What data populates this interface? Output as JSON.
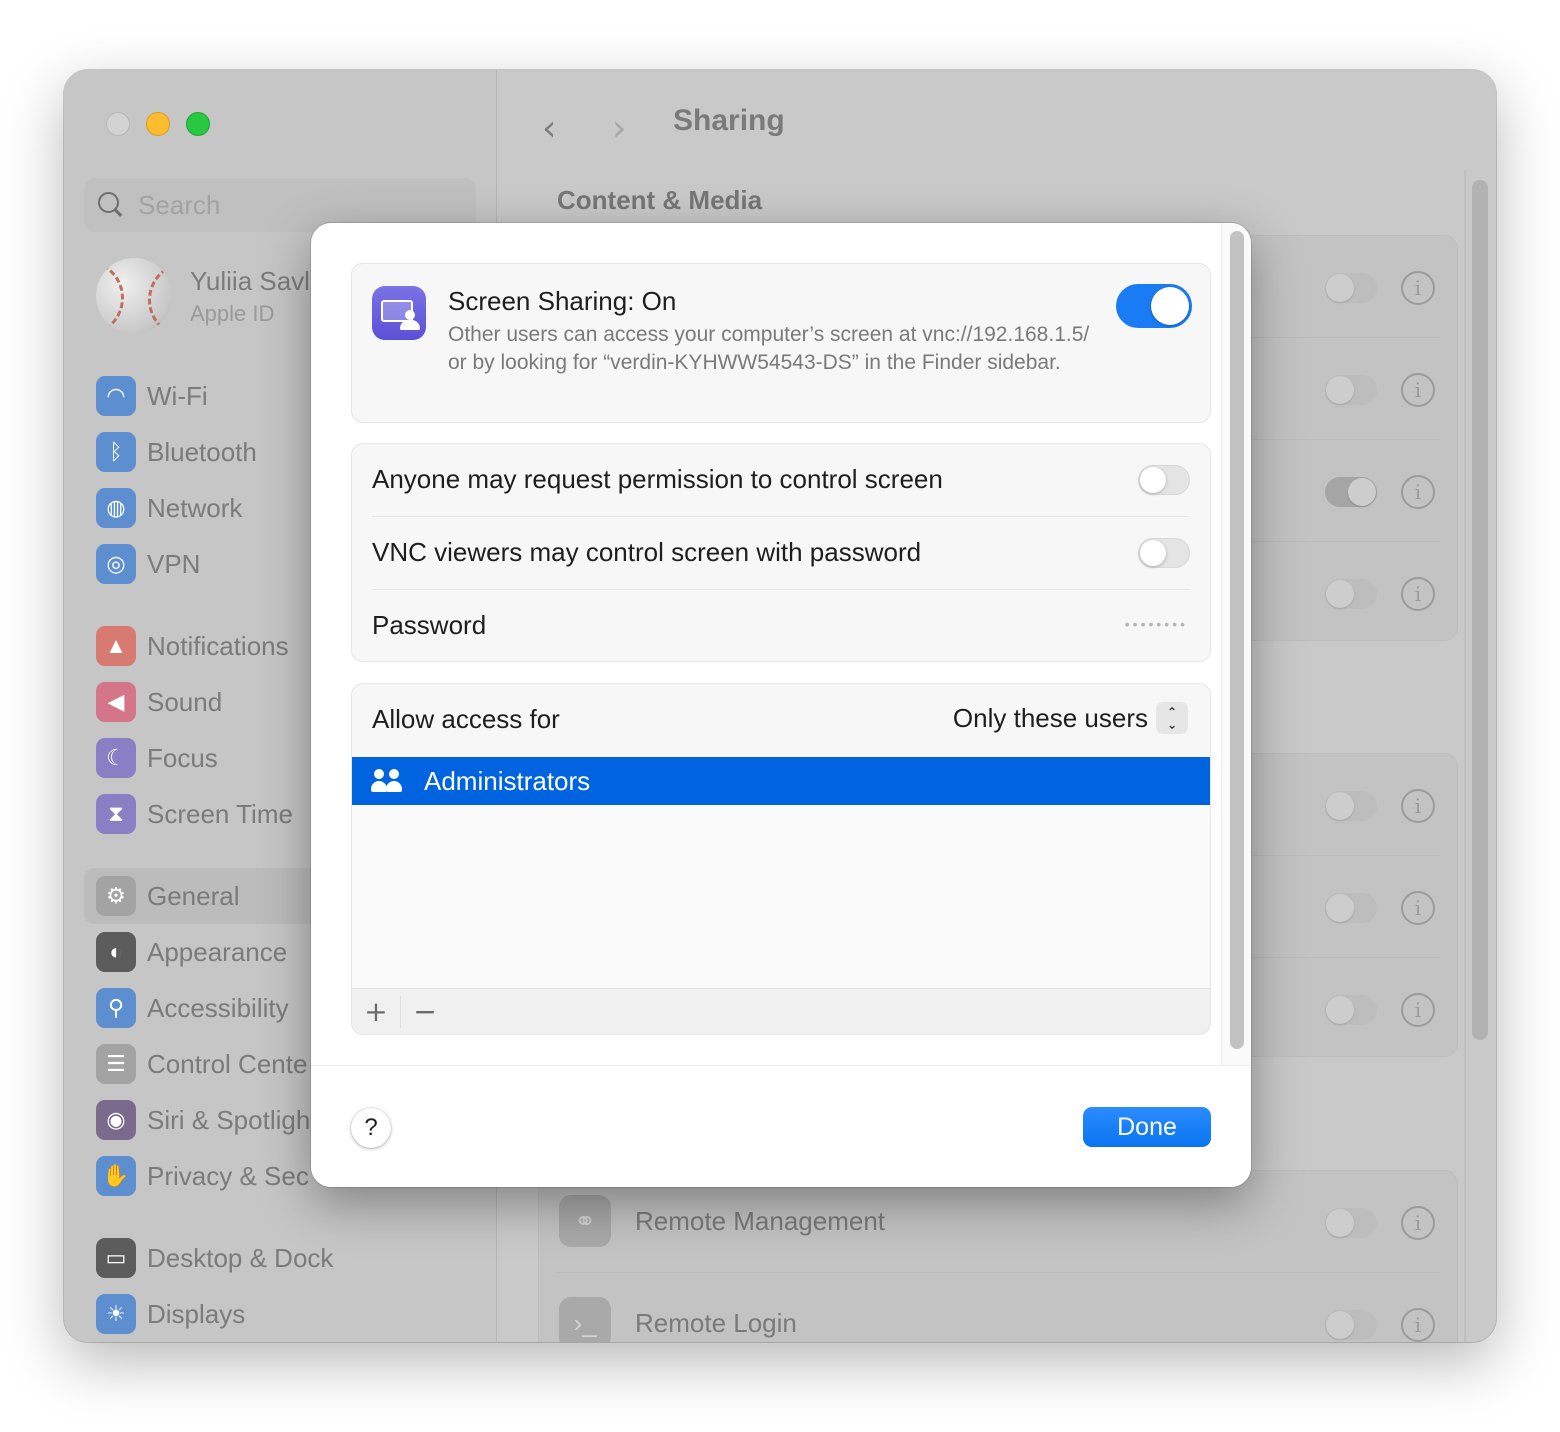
{
  "window": {
    "sidebar": {
      "search_placeholder": "Search",
      "profile": {
        "name": "Yuliia Savl",
        "subtitle": "Apple ID"
      },
      "groups": [
        [
          {
            "label": "Wi-Fi",
            "icon": "wifi-icon",
            "glyph": "◠",
            "color": "#5d8fd0"
          },
          {
            "label": "Bluetooth",
            "icon": "bluetooth-icon",
            "glyph": "ᛒ",
            "color": "#5d8fd0"
          },
          {
            "label": "Network",
            "icon": "globe-icon",
            "glyph": "◍",
            "color": "#5d8fd0"
          },
          {
            "label": "VPN",
            "icon": "vpn-globe-icon",
            "glyph": "◎",
            "color": "#5d8fd0"
          }
        ],
        [
          {
            "label": "Notifications",
            "icon": "bell-icon",
            "glyph": "▲",
            "color": "#d77b72"
          },
          {
            "label": "Sound",
            "icon": "speaker-icon",
            "glyph": "◀",
            "color": "#d5758a"
          },
          {
            "label": "Focus",
            "icon": "moon-icon",
            "glyph": "☾",
            "color": "#8a7fc4"
          },
          {
            "label": "Screen Time",
            "icon": "hourglass-icon",
            "glyph": "⧗",
            "color": "#8a7fc4"
          }
        ],
        [
          {
            "label": "General",
            "icon": "gear-icon",
            "glyph": "⚙",
            "color": "#a3a3a3",
            "selected": true
          },
          {
            "label": "Appearance",
            "icon": "appearance-icon",
            "glyph": "◐",
            "color": "#5c5c5c"
          },
          {
            "label": "Accessibility",
            "icon": "accessibility-icon",
            "glyph": "⚲",
            "color": "#5d8fd0"
          },
          {
            "label": "Control Cente",
            "icon": "control-center-icon",
            "glyph": "☰",
            "color": "#a3a3a3"
          },
          {
            "label": "Siri & Spotligh",
            "icon": "siri-icon",
            "glyph": "◉",
            "color": "#7a6a8c"
          },
          {
            "label": "Privacy & Sec",
            "icon": "hand-icon",
            "glyph": "✋",
            "color": "#5d8fd0"
          }
        ],
        [
          {
            "label": "Desktop & Dock",
            "icon": "dock-icon",
            "glyph": "▭",
            "color": "#5c5c5c"
          },
          {
            "label": "Displays",
            "icon": "sun-icon",
            "glyph": "☀",
            "color": "#5d8fd0"
          }
        ]
      ]
    },
    "content": {
      "title": "Sharing",
      "section_title": "Content & Media",
      "background_rows_group1": [
        {
          "on": false
        },
        {
          "on": false
        },
        {
          "on": true
        },
        {
          "on": false
        }
      ],
      "background_rows_group2": [
        {
          "on": false
        },
        {
          "on": false
        },
        {
          "on": false
        }
      ],
      "background_rows_group3": [
        {
          "label": "Remote Management",
          "icon": "binoculars-icon",
          "glyph": "⚭",
          "on": false
        },
        {
          "label": "Remote Login",
          "icon": "terminal-icon",
          "glyph": "›_",
          "on": false
        }
      ]
    }
  },
  "dialog": {
    "service": {
      "title": "Screen Sharing: On",
      "description": "Other users can access your computer’s screen at vnc://192.168.1.5/ or by looking for “verdin-KYHWW54543-DS” in the Finder sidebar.",
      "enabled": true
    },
    "options": [
      {
        "label": "Anyone may request permission to control screen",
        "on": false
      },
      {
        "label": "VNC viewers may control screen with password",
        "on": false
      }
    ],
    "password": {
      "label": "Password",
      "masked_value": "••••••••"
    },
    "access": {
      "label": "Allow access for",
      "selected": "Only these users",
      "users": [
        {
          "name": "Administrators",
          "selected": true
        }
      ],
      "add_label": "+",
      "remove_label": "−"
    },
    "help_label": "?",
    "done_label": "Done"
  }
}
